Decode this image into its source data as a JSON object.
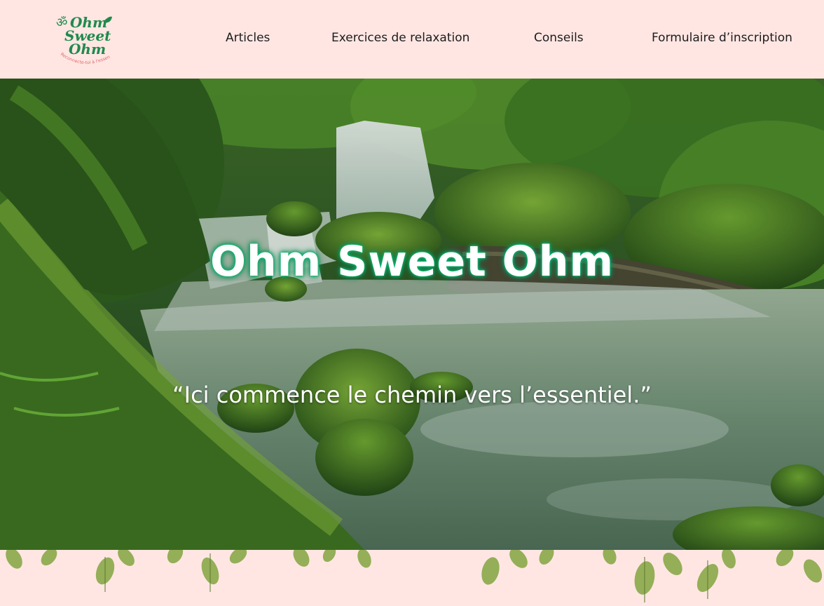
{
  "brand": {
    "logo_line1": "Ohm",
    "logo_line2": "Sweet",
    "logo_line3": "Ohm",
    "logo_tagline": "Reconnecte-toi à l'essentiel",
    "logo_symbol": "ॐ",
    "primary_color": "#1f8a4c",
    "accent_color": "#e06a6a"
  },
  "nav": {
    "items": [
      {
        "label": "Articles"
      },
      {
        "label": "Exercices de relaxation"
      },
      {
        "label": "Conseils"
      },
      {
        "label": "Formulaire d’inscription"
      }
    ]
  },
  "hero": {
    "title": "Ohm Sweet Ohm",
    "quote": "“Ici commence le chemin vers l’essentiel.”",
    "glow_color": "#13b26f"
  },
  "colors": {
    "background": "#ffe6e3",
    "text": "#1c1c1c"
  }
}
